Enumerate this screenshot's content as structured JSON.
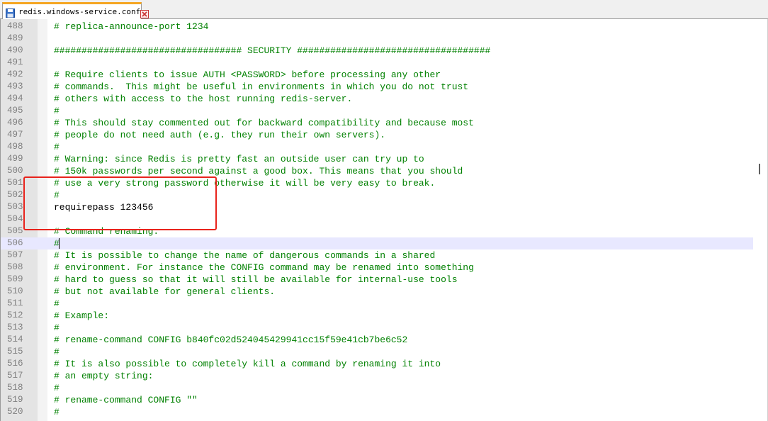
{
  "tab": {
    "title": "redis.windows-service.conf",
    "save_icon": "save-icon",
    "close_icon": "close-icon"
  },
  "colors": {
    "comment": "#008000",
    "code": "#000000",
    "line_number": "#808080",
    "current_line": "#e8e8ff",
    "annotation_box": "#e8231c"
  },
  "editor": {
    "lines": [
      {
        "n": "488",
        "text": "# replica-announce-port 1234",
        "type": "comment"
      },
      {
        "n": "489",
        "text": "",
        "type": "comment"
      },
      {
        "n": "490",
        "text": "################################## SECURITY ###################################",
        "type": "comment"
      },
      {
        "n": "491",
        "text": "",
        "type": "comment"
      },
      {
        "n": "492",
        "text": "# Require clients to issue AUTH <PASSWORD> before processing any other",
        "type": "comment"
      },
      {
        "n": "493",
        "text": "# commands.  This might be useful in environments in which you do not trust",
        "type": "comment"
      },
      {
        "n": "494",
        "text": "# others with access to the host running redis-server.",
        "type": "comment"
      },
      {
        "n": "495",
        "text": "#",
        "type": "comment"
      },
      {
        "n": "496",
        "text": "# This should stay commented out for backward compatibility and because most",
        "type": "comment"
      },
      {
        "n": "497",
        "text": "# people do not need auth (e.g. they run their own servers).",
        "type": "comment"
      },
      {
        "n": "498",
        "text": "#",
        "type": "comment"
      },
      {
        "n": "499",
        "text": "# Warning: since Redis is pretty fast an outside user can try up to",
        "type": "comment"
      },
      {
        "n": "500",
        "text": "# 150k passwords per second against a good box. This means that you should",
        "type": "comment"
      },
      {
        "n": "501",
        "text": "# use a very strong password otherwise it will be very easy to break.",
        "type": "comment"
      },
      {
        "n": "502",
        "text": "#",
        "type": "comment"
      },
      {
        "n": "503",
        "text": "requirepass 123456",
        "type": "code"
      },
      {
        "n": "504",
        "text": "",
        "type": "comment"
      },
      {
        "n": "505",
        "text": "# Command renaming.",
        "type": "comment"
      },
      {
        "n": "506",
        "text": "#",
        "type": "comment",
        "current": true
      },
      {
        "n": "507",
        "text": "# It is possible to change the name of dangerous commands in a shared",
        "type": "comment"
      },
      {
        "n": "508",
        "text": "# environment. For instance the CONFIG command may be renamed into something",
        "type": "comment"
      },
      {
        "n": "509",
        "text": "# hard to guess so that it will still be available for internal-use tools",
        "type": "comment"
      },
      {
        "n": "510",
        "text": "# but not available for general clients.",
        "type": "comment"
      },
      {
        "n": "511",
        "text": "#",
        "type": "comment"
      },
      {
        "n": "512",
        "text": "# Example:",
        "type": "comment"
      },
      {
        "n": "513",
        "text": "#",
        "type": "comment"
      },
      {
        "n": "514",
        "text": "# rename-command CONFIG b840fc02d524045429941cc15f59e41cb7be6c52",
        "type": "comment"
      },
      {
        "n": "515",
        "text": "#",
        "type": "comment"
      },
      {
        "n": "516",
        "text": "# It is also possible to completely kill a command by renaming it into",
        "type": "comment"
      },
      {
        "n": "517",
        "text": "# an empty string:",
        "type": "comment"
      },
      {
        "n": "518",
        "text": "#",
        "type": "comment"
      },
      {
        "n": "519",
        "text": "# rename-command CONFIG \"\"",
        "type": "comment"
      },
      {
        "n": "520",
        "text": "#",
        "type": "comment"
      }
    ]
  }
}
